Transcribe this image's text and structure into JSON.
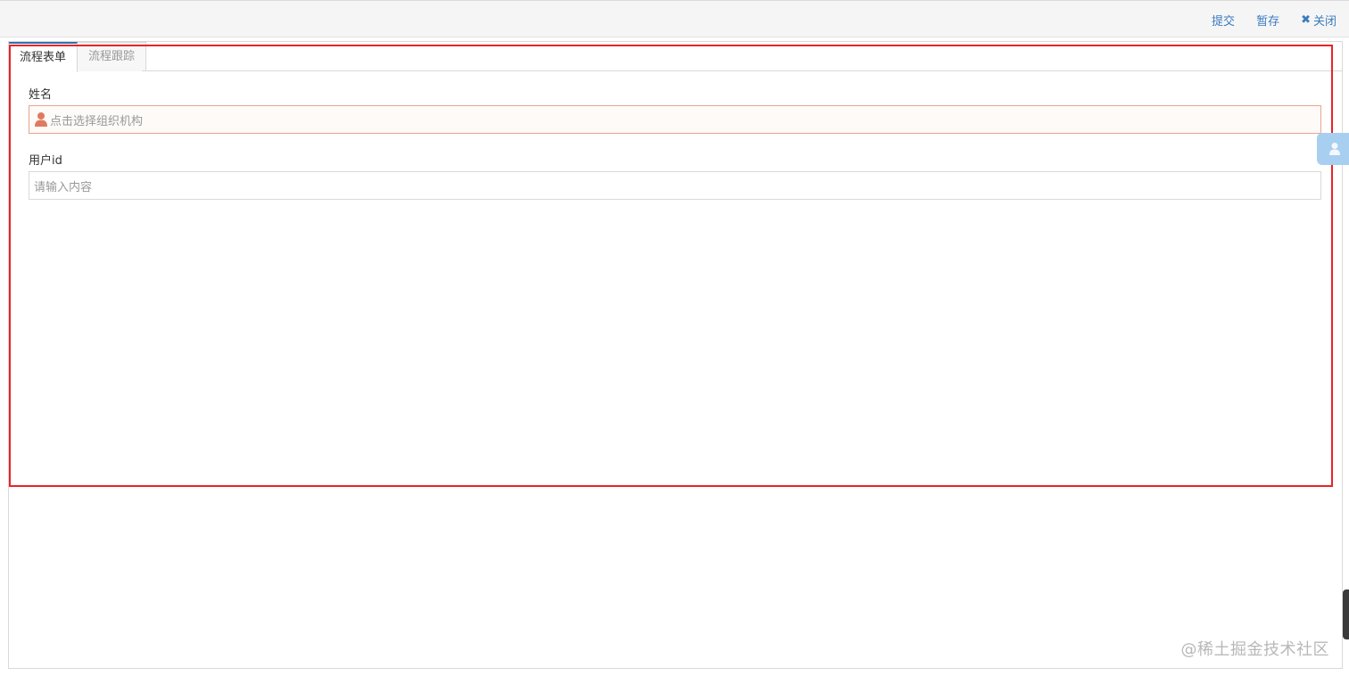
{
  "toolbar": {
    "submit_label": "提交",
    "save_draft_label": "暂存",
    "close_label": "关闭"
  },
  "tabs": [
    {
      "label": "流程表单",
      "active": true
    },
    {
      "label": "流程跟踪",
      "active": false
    }
  ],
  "form": {
    "name_label": "姓名",
    "name_placeholder": "点击选择组织机构",
    "userid_label": "用户id",
    "userid_placeholder": "请输入内容"
  },
  "watermark": "@稀土掘金技术社区",
  "colors": {
    "link": "#3a7bbf",
    "active_tab_accent": "#2f6fb3",
    "highlight_box": "#e8242a",
    "user_icon": "#e07a5f"
  },
  "icons": {
    "close": "close-icon",
    "user": "user-icon"
  }
}
